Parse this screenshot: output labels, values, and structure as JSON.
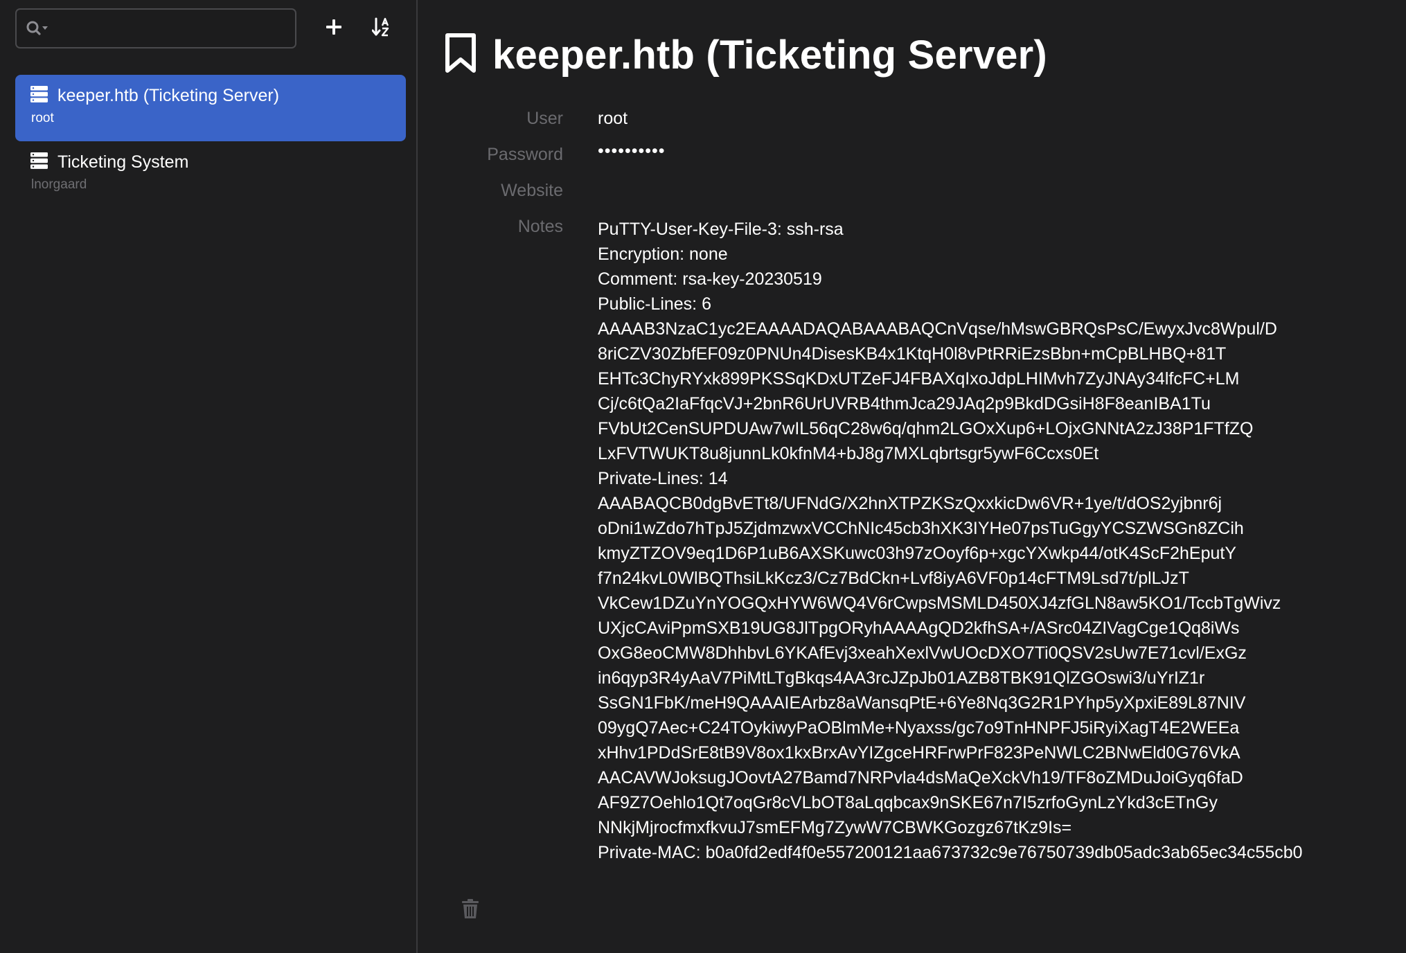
{
  "search": {
    "placeholder": ""
  },
  "toolbar": {
    "add_icon": "plus-icon",
    "sort_icon": "sort-alpha-icon"
  },
  "sidebar": {
    "entries": [
      {
        "title": "keeper.htb (Ticketing Server)",
        "subtitle": "root",
        "icon": "server-icon",
        "selected": true
      },
      {
        "title": "Ticketing System",
        "subtitle": "lnorgaard",
        "icon": "server-icon",
        "selected": false
      }
    ]
  },
  "detail": {
    "title": "keeper.htb (Ticketing Server)",
    "header_icon": "bookmark-icon",
    "labels": {
      "user": "User",
      "password": "Password",
      "website": "Website",
      "notes": "Notes"
    },
    "values": {
      "user": "root",
      "password": "••••••••••",
      "website": ""
    },
    "notes": [
      "PuTTY-User-Key-File-3: ssh-rsa",
      "Encryption: none",
      "Comment: rsa-key-20230519",
      "Public-Lines: 6",
      "AAAAB3NzaC1yc2EAAAADAQABAAABAQCnVqse/hMswGBRQsPsC/EwyxJvc8Wpul/D",
      "8riCZV30ZbfEF09z0PNUn4DisesKB4x1KtqH0l8vPtRRiEzsBbn+mCpBLHBQ+81T",
      "EHTc3ChyRYxk899PKSSqKDxUTZeFJ4FBAXqIxoJdpLHIMvh7ZyJNAy34lfcFC+LM",
      "Cj/c6tQa2IaFfqcVJ+2bnR6UrUVRB4thmJca29JAq2p9BkdDGsiH8F8eanIBA1Tu",
      "FVbUt2CenSUPDUAw7wIL56qC28w6q/qhm2LGOxXup6+LOjxGNNtA2zJ38P1FTfZQ",
      "LxFVTWUKT8u8junnLk0kfnM4+bJ8g7MXLqbrtsgr5ywF6Ccxs0Et",
      "Private-Lines: 14",
      "AAABAQCB0dgBvETt8/UFNdG/X2hnXTPZKSzQxxkicDw6VR+1ye/t/dOS2yjbnr6j",
      "oDni1wZdo7hTpJ5ZjdmzwxVCChNIc45cb3hXK3IYHe07psTuGgyYCSZWSGn8ZCih",
      "kmyZTZOV9eq1D6P1uB6AXSKuwc03h97zOoyf6p+xgcYXwkp44/otK4ScF2hEputY",
      "f7n24kvL0WlBQThsiLkKcz3/Cz7BdCkn+Lvf8iyA6VF0p14cFTM9Lsd7t/plLJzT",
      "VkCew1DZuYnYOGQxHYW6WQ4V6rCwpsMSMLD450XJ4zfGLN8aw5KO1/TccbTgWivz",
      "UXjcCAviPpmSXB19UG8JlTpgORyhAAAAgQD2kfhSA+/ASrc04ZIVagCge1Qq8iWs",
      "OxG8eoCMW8DhhbvL6YKAfEvj3xeahXexlVwUOcDXO7Ti0QSV2sUw7E71cvl/ExGz",
      "in6qyp3R4yAaV7PiMtLTgBkqs4AA3rcJZpJb01AZB8TBK91QlZGOswi3/uYrIZ1r",
      "SsGN1FbK/meH9QAAAIEArbz8aWansqPtE+6Ye8Nq3G2R1PYhp5yXpxiE89L87NIV",
      "09ygQ7Aec+C24TOykiwyPaOBlmMe+Nyaxss/gc7o9TnHNPFJ5iRyiXagT4E2WEEa",
      "xHhv1PDdSrE8tB9V8ox1kxBrxAvYIZgceHRFrwPrF823PeNWLC2BNwEld0G76VkA",
      "AACAVWJoksugJOovtA27Bamd7NRPvla4dsMaQeXckVh19/TF8oZMDuJoiGyq6faD",
      "AF9Z7Oehlo1Qt7oqGr8cVLbOT8aLqqbcax9nSKE67n7I5zrfoGynLzYkd3cETnGy",
      "NNkjMjrocfmxfkvuJ7smEFMg7ZywW7CBWKGozgz67tKz9Is=",
      "Private-MAC: b0a0fd2edf4f0e557200121aa673732c9e76750739db05adc3ab65ec34c55cb0"
    ],
    "footer_icon": "trash-icon"
  }
}
